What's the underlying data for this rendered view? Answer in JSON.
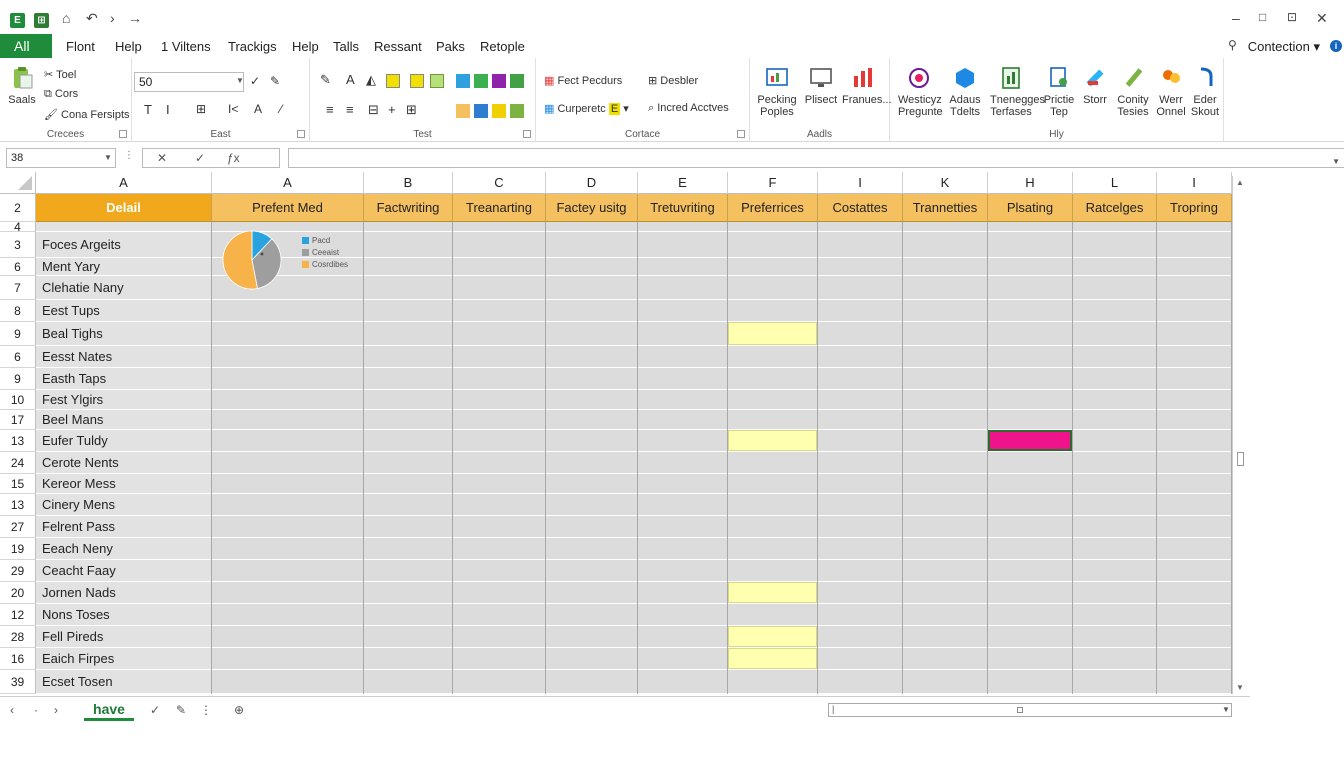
{
  "titlebar": {
    "window_controls": [
      "–",
      "□",
      "⊡",
      "✕"
    ]
  },
  "menu": {
    "all": "All",
    "items": [
      "Flont",
      "Help",
      "1 Viltens",
      "Trackigs",
      "Help",
      "Talls",
      "Ressant",
      "Paks",
      "Retople"
    ],
    "connection": "Contection"
  },
  "ribbon": {
    "clipboard": {
      "big": "Saals",
      "items": [
        "Toel",
        "Cors",
        "Cona Fersipts"
      ],
      "label": "Crecees"
    },
    "font": {
      "fontbox": "50",
      "label": "East"
    },
    "text": {
      "label": "Test"
    },
    "condition": {
      "items": [
        "Fect Pecdurs",
        "Curperetc",
        "Desbler",
        "Incred Acctves"
      ],
      "label": "Cortace"
    },
    "aadls": {
      "buttons": [
        "Pecking Poples",
        "Plisect",
        "Franues..."
      ],
      "label": "Aadls"
    },
    "hly": {
      "buttons": [
        "Westicyz Pregunte",
        "Adaus Tdelts",
        "Tnenegges Terfases",
        "Prictie Tep",
        "Storr",
        "Conity Tesies",
        "Werr Onnel",
        "Eder Skout"
      ],
      "label": "Hly"
    }
  },
  "formula": {
    "namebox": "38",
    "fx_symbols": [
      "✕",
      "✓",
      "ƒx"
    ]
  },
  "grid": {
    "col_letters": [
      "A",
      "A",
      "B",
      "C",
      "D",
      "E",
      "F",
      "I",
      "K",
      "H",
      "L",
      "I"
    ],
    "headers": [
      "Delail",
      "Prefent Med",
      "Factwriting",
      "Treanarting",
      "Factey usitg",
      "Tretuvriting",
      "Preferrices",
      "Costattes",
      "Trannetties",
      "Plsating",
      "Ratcelges",
      "Tropring"
    ],
    "header_row_label": "2",
    "rows": [
      {
        "num": "4",
        "name": ""
      },
      {
        "num": "3",
        "name": "Foces Argeits"
      },
      {
        "num": "6",
        "name": "Ment Yary"
      },
      {
        "num": "7",
        "name": "Clehatie Nany"
      },
      {
        "num": "8",
        "name": "Eest Tups"
      },
      {
        "num": "9",
        "name": "Beal Tighs"
      },
      {
        "num": "6",
        "name": "Eesst Nates"
      },
      {
        "num": "9",
        "name": "Easth Taps"
      },
      {
        "num": "10",
        "name": "Fest Ylgirs"
      },
      {
        "num": "17",
        "name": "Beel Mans"
      },
      {
        "num": "13",
        "name": "Eufer Tuldy"
      },
      {
        "num": "24",
        "name": "Cerote Nents"
      },
      {
        "num": "15",
        "name": "Kereor Mess"
      },
      {
        "num": "13",
        "name": "Cinery Mens"
      },
      {
        "num": "27",
        "name": "Felrent Pass"
      },
      {
        "num": "19",
        "name": "Eeach Neny"
      },
      {
        "num": "29",
        "name": "Ceacht Fаay"
      },
      {
        "num": "20",
        "name": "Jornen Nads"
      },
      {
        "num": "12",
        "name": "Nons Toses"
      },
      {
        "num": "28",
        "name": "Fell Pireds"
      },
      {
        "num": "16",
        "name": "Eaich Firpes"
      },
      {
        "num": "39",
        "name": "Ecset Tosen"
      }
    ],
    "highlights": [
      {
        "row": 5,
        "col": 6,
        "color": "#ffffb0"
      },
      {
        "row": 10,
        "col": 6,
        "color": "#ffffb0"
      },
      {
        "row": 10,
        "col": 9,
        "color": "#f0148c"
      },
      {
        "row": 17,
        "col": 6,
        "color": "#ffffb0"
      },
      {
        "row": 19,
        "col": 6,
        "color": "#ffffb0"
      },
      {
        "row": 20,
        "col": 6,
        "color": "#ffffb0"
      }
    ],
    "accent_header": "#f5c160",
    "accent_header_first": "#f2a81d"
  },
  "chart_data": {
    "type": "pie",
    "title": "",
    "slices": [
      {
        "label": "Pacd",
        "value": 12,
        "color": "#29a3e0"
      },
      {
        "label": "Ceeaist",
        "value": 35,
        "color": "#9e9e9e"
      },
      {
        "label": "Cosrdibes",
        "value": 53,
        "color": "#f7b34a"
      }
    ],
    "legend_position": "right"
  },
  "sheet": {
    "tab": "have"
  }
}
